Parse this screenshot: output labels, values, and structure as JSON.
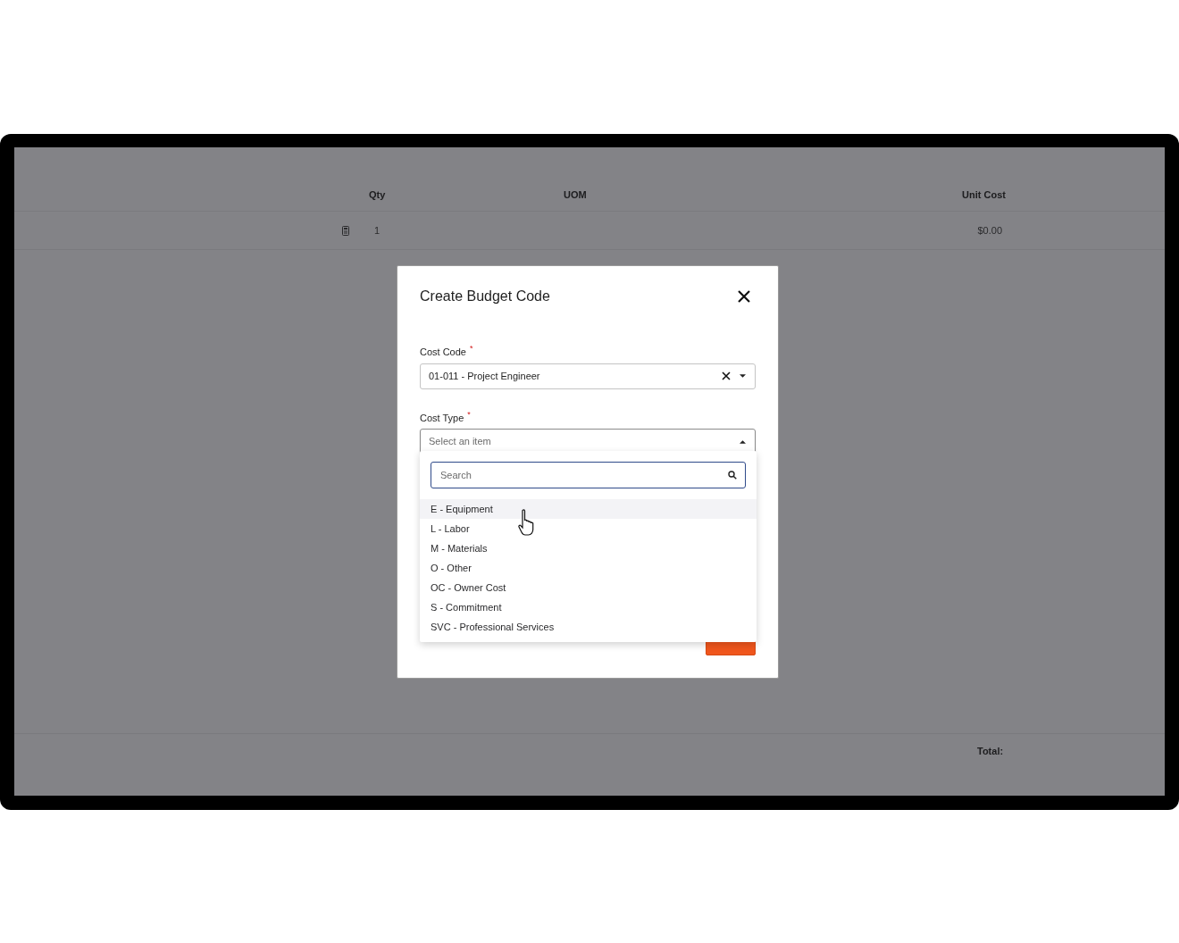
{
  "table": {
    "columns": [
      "Qty",
      "UOM",
      "Unit Cost"
    ],
    "rows": [
      {
        "qty": "1",
        "uom": "",
        "unit_cost": "$0.00"
      }
    ],
    "footer": {
      "total_label": "Total:"
    }
  },
  "dialog": {
    "title": "Create Budget Code",
    "fields": [
      {
        "label": "Cost Code",
        "required_mark": "*",
        "value": "01-011 - Project Engineer",
        "clearable": true,
        "open": false
      },
      {
        "label": "Cost Type",
        "required_mark": "*",
        "placeholder": "Select an item",
        "open": true
      }
    ],
    "dropdown": {
      "search_placeholder": "Search",
      "options": [
        {
          "label": "E - Equipment",
          "highlighted": true
        },
        {
          "label": "L - Labor",
          "highlighted": false
        },
        {
          "label": "M - Materials",
          "highlighted": false
        },
        {
          "label": "O - Other",
          "highlighted": false
        },
        {
          "label": "OC - Owner Cost",
          "highlighted": false
        },
        {
          "label": "S - Commitment",
          "highlighted": false
        },
        {
          "label": "SVC - Professional Services",
          "highlighted": false
        }
      ]
    },
    "buttons": [
      {
        "kind": "primary"
      }
    ]
  }
}
